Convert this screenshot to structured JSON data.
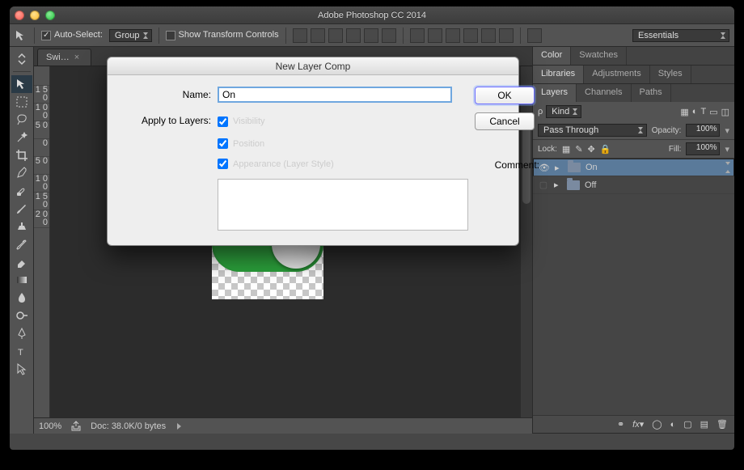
{
  "window": {
    "title": "Adobe Photoshop CC 2014"
  },
  "optionsBar": {
    "autoSelect": {
      "label": "Auto-Select:",
      "checked": true
    },
    "typeSelect": {
      "value": "Group"
    },
    "showTransform": {
      "label": "Show Transform Controls",
      "checked": false
    },
    "workspace": {
      "value": "Essentials"
    }
  },
  "docTab": {
    "label": "Swi…"
  },
  "rulerMarks": [
    "",
    "1\n5\n0",
    "1\n0\n0",
    "5\n0",
    "0",
    "5\n0",
    "1\n0\n0",
    "1\n5\n0",
    "2\n0\n0"
  ],
  "statusBar": {
    "zoom": "100%",
    "docinfo": "Doc: 38.0K/0 bytes"
  },
  "panels": {
    "colorTabs": {
      "color": "Color",
      "swatches": "Swatches"
    },
    "librariesTabs": {
      "libraries": "Libraries",
      "adjustments": "Adjustments",
      "styles": "Styles"
    },
    "layersTabs": {
      "layers": "Layers",
      "channels": "Channels",
      "paths": "Paths"
    },
    "layersOptions": {
      "kind": "Kind",
      "blendMode": "Pass Through",
      "opacityLabel": "Opacity:",
      "opacityValue": "100%",
      "lockLabel": "Lock:",
      "fillLabel": "Fill:",
      "fillValue": "100%"
    },
    "layers": [
      {
        "name": "On",
        "visible": true,
        "selected": true
      },
      {
        "name": "Off",
        "visible": false,
        "selected": false
      }
    ]
  },
  "dialog": {
    "title": "New Layer Comp",
    "nameLabel": "Name:",
    "nameValue": "On",
    "applyLabel": "Apply to Layers:",
    "visibility": {
      "label": "Visibility",
      "checked": true
    },
    "position": {
      "label": "Position",
      "checked": true
    },
    "appearance": {
      "label": "Appearance (Layer Style)",
      "checked": true
    },
    "commentLabel": "Comment:",
    "commentValue": "",
    "ok": "OK",
    "cancel": "Cancel"
  }
}
